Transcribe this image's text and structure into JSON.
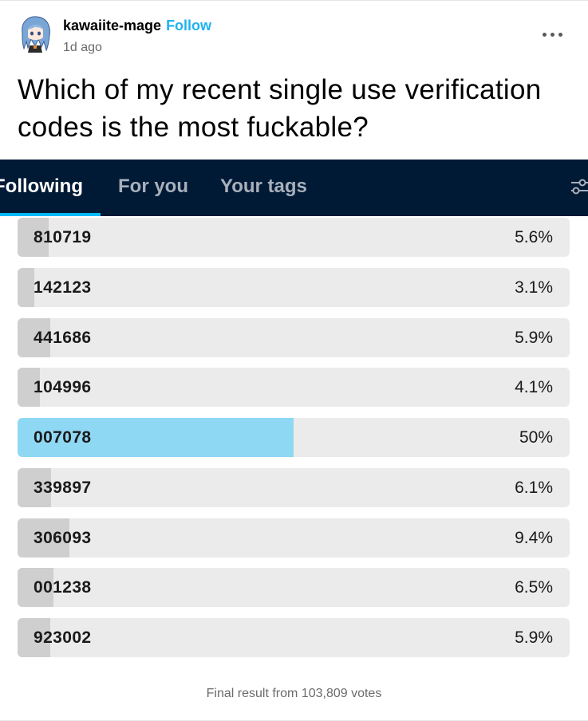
{
  "author": {
    "name": "kawaiite-mage",
    "follow_label": "Follow",
    "timestamp": "1d ago"
  },
  "question": "Which of my recent single use verification codes is the most fuckable?",
  "tabs": [
    {
      "label": "Following",
      "active": true
    },
    {
      "label": "For you",
      "active": false
    },
    {
      "label": "Your tags",
      "active": false
    }
  ],
  "colors": {
    "accent": "#00b8ff",
    "follow": "#1fb3f0",
    "winner_fill": "#8fd8f4",
    "bar_fill": "#cfcfcf",
    "tab_bar": "#001935"
  },
  "poll": {
    "options": [
      {
        "code": "810719",
        "percent": "5.6%",
        "value": 5.6
      },
      {
        "code": "142123",
        "percent": "3.1%",
        "value": 3.1
      },
      {
        "code": "441686",
        "percent": "5.9%",
        "value": 5.9
      },
      {
        "code": "104996",
        "percent": "4.1%",
        "value": 4.1
      },
      {
        "code": "007078",
        "percent": "50%",
        "value": 50,
        "winner": true
      },
      {
        "code": "339897",
        "percent": "6.1%",
        "value": 6.1
      },
      {
        "code": "306093",
        "percent": "9.4%",
        "value": 9.4
      },
      {
        "code": "001238",
        "percent": "6.5%",
        "value": 6.5
      },
      {
        "code": "923002",
        "percent": "5.9%",
        "value": 5.9
      }
    ],
    "final_result": "Final result from 103,809 votes"
  },
  "icons": {
    "more": "more-horizontal-icon",
    "settings": "sliders-icon"
  }
}
